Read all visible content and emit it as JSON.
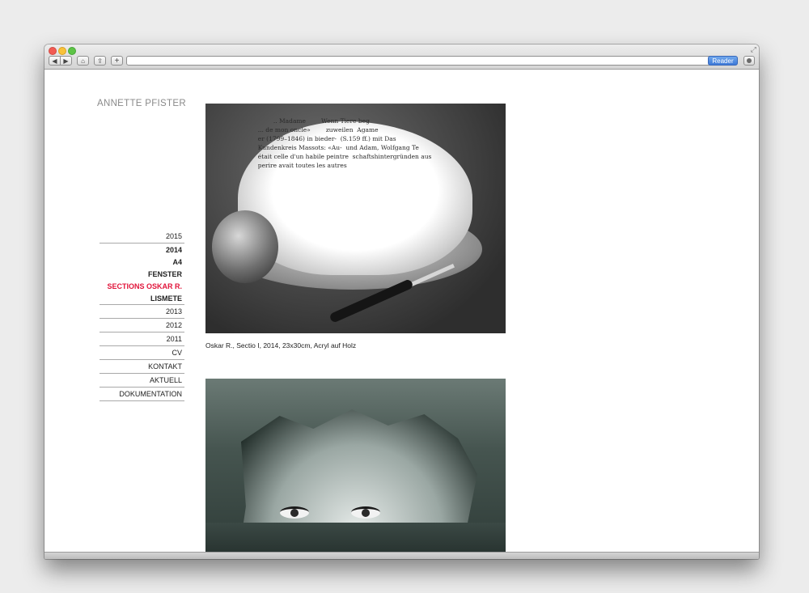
{
  "browser": {
    "reader_label": "Reader",
    "back_glyph": "◀",
    "forward_glyph": "▶",
    "home_glyph": "⌂",
    "share_glyph": "⇪",
    "plus_glyph": "+",
    "reload_glyph": "↻",
    "fullscreen_glyph": "⤢"
  },
  "site": {
    "title": "ANNETTE PFISTER"
  },
  "nav": {
    "year_2015": "2015",
    "year_2014": "2014",
    "sub_a4": "A4",
    "sub_fenster": "FENSTER",
    "sub_sections": "SECTIONS OSKAR R.",
    "sub_lismete": "LISMETE",
    "year_2013": "2013",
    "year_2012": "2012",
    "year_2011": "2011",
    "cv": "CV",
    "kontakt": "KONTAKT",
    "aktuell": "AKTUELL",
    "dokumentation": "DOKUMENTATION"
  },
  "gallery": {
    "caption_1": "Oskar R., Sectio I, 2014, 23x30cm, Acryl auf Holz",
    "painting_1_text": "          .. Madame        Wenn Tiere beg\n  ... de mon oncle»        zuweilen  Agame\n  er (1799–1846) in bieder-  (S.159 ff.) mit Das\n  Kundenkreis Massots: «Au-  und Adam, Wolfgang Te\n  était celle d'un habile peintre  schaftshintergründen aus\n  perire avait toutes les autres"
  },
  "colors": {
    "active_nav": "#e1143a",
    "title_gray": "#8a8a8a"
  }
}
